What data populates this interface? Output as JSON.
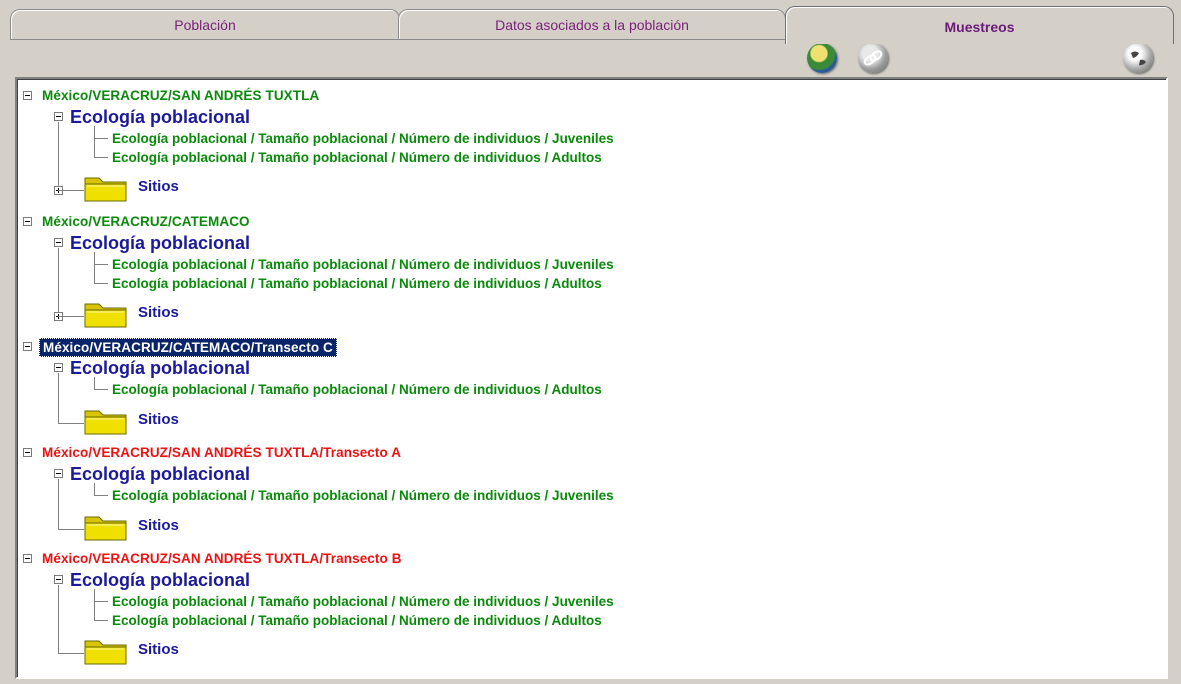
{
  "tabs": [
    {
      "label": "Población"
    },
    {
      "label": "Datos asociados a la población"
    },
    {
      "label": "Muestreos"
    }
  ],
  "toolbar": {
    "icons": [
      "refresh-globe-icon",
      "link-icon",
      "world-icon"
    ]
  },
  "colors": {
    "green": "#0a8a0a",
    "red": "#ee1111",
    "blue": "#1a1a9a",
    "selection": "#0a246a"
  },
  "tree": [
    {
      "label": "México/VERACRUZ/SAN ANDRÉS TUXTLA",
      "color": "green",
      "eco": "Ecología poblacional",
      "leaves": [
        "Ecología poblacional / Tamaño poblacional / Número de individuos / Juveniles",
        "Ecología poblacional / Tamaño poblacional / Número de individuos / Adultos"
      ],
      "sitios": "Sitios"
    },
    {
      "label": "México/VERACRUZ/CATEMACO",
      "color": "green",
      "eco": "Ecología poblacional",
      "leaves": [
        "Ecología poblacional / Tamaño poblacional / Número de individuos / Juveniles",
        "Ecología poblacional / Tamaño poblacional / Número de individuos / Adultos"
      ],
      "sitios": "Sitios"
    },
    {
      "label": "México/VERACRUZ/CATEMACO/Transecto C",
      "color": "selected",
      "eco": "Ecología poblacional",
      "leaves": [
        "Ecología poblacional / Tamaño poblacional / Número de individuos / Adultos"
      ],
      "sitios": "Sitios"
    },
    {
      "label": "México/VERACRUZ/SAN ANDRÉS TUXTLA/Transecto A",
      "color": "red",
      "eco": "Ecología poblacional",
      "leaves": [
        "Ecología poblacional / Tamaño poblacional / Número de individuos / Juveniles"
      ],
      "sitios": "Sitios"
    },
    {
      "label": "México/VERACRUZ/SAN ANDRÉS TUXTLA/Transecto B",
      "color": "red",
      "eco": "Ecología poblacional",
      "leaves": [
        "Ecología poblacional / Tamaño poblacional / Número de individuos / Juveniles",
        "Ecología poblacional / Tamaño poblacional / Número de individuos / Adultos"
      ],
      "sitios": "Sitios"
    }
  ]
}
